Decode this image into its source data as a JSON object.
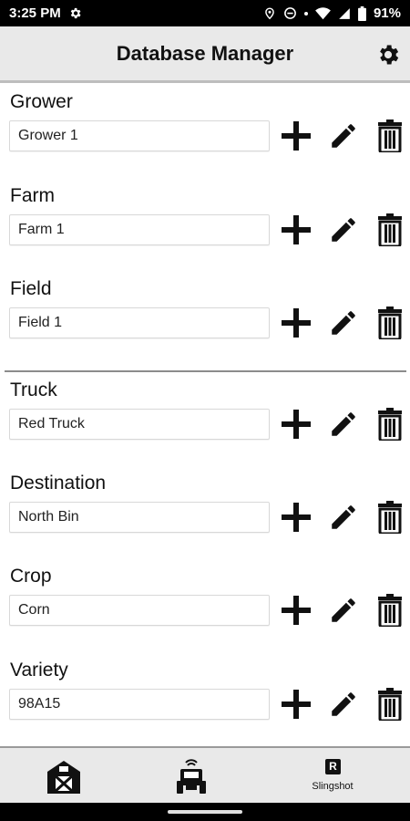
{
  "status_bar": {
    "time": "3:25 PM",
    "battery": "91%",
    "icons": [
      "gear-icon",
      "location-icon",
      "dnd-icon",
      "wifi-icon",
      "battery-icon"
    ]
  },
  "header": {
    "title": "Database Manager",
    "settings_icon": "gear-icon"
  },
  "sections": [
    {
      "label": "Grower",
      "value": "Grower 1"
    },
    {
      "label": "Farm",
      "value": "Farm 1"
    },
    {
      "label": "Field",
      "value": "Field 1"
    },
    {
      "label": "Truck",
      "value": "Red Truck"
    },
    {
      "label": "Destination",
      "value": "North Bin"
    },
    {
      "label": "Crop",
      "value": "Corn"
    },
    {
      "label": "Variety",
      "value": "98A15"
    }
  ],
  "row_actions": [
    "plus-icon",
    "pencil-icon",
    "trash-icon"
  ],
  "bottom_nav": {
    "items": [
      {
        "icon": "barn-icon",
        "label": ""
      },
      {
        "icon": "tractor-icon",
        "label": ""
      },
      {
        "icon": "slingshot-icon",
        "label": "Slingshot",
        "badge": "R"
      }
    ]
  },
  "colors": {
    "header_bg": "#e9e9e9",
    "status_bg": "#000000",
    "icon": "#111111"
  }
}
